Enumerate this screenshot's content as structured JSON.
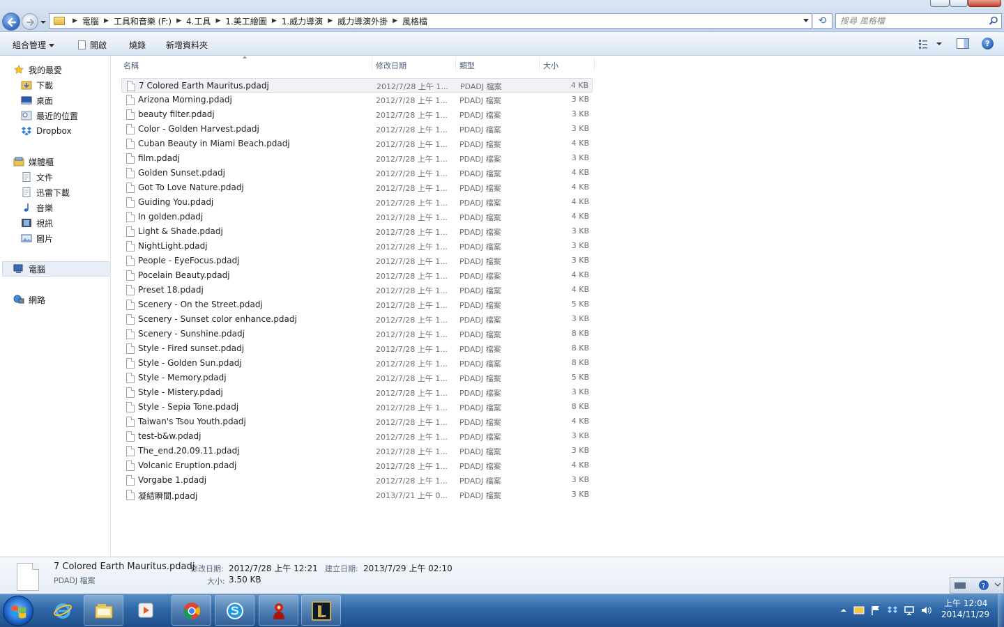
{
  "address": {
    "crumbs": [
      "電腦",
      "工具和音樂 (F:)",
      "4.工具",
      "1.美工繪圖",
      "1.威力導演",
      "威力導演外掛",
      "風格檔"
    ]
  },
  "search": {
    "placeholder": "搜尋 風格檔"
  },
  "commands": {
    "organize": "組合管理",
    "open": "開啟",
    "burn": "燒錄",
    "new_folder": "新增資料夾"
  },
  "nav": {
    "favorites": "我的最愛",
    "downloads": "下載",
    "desktop": "桌面",
    "recent": "最近的位置",
    "dropbox": "Dropbox",
    "libraries": "媒體櫃",
    "documents": "文件",
    "xunlei": "迅雷下載",
    "music": "音樂",
    "videos": "視訊",
    "pictures": "圖片",
    "computer": "電腦",
    "network": "網路"
  },
  "columns": {
    "name": "名稱",
    "modified": "修改日期",
    "type": "類型",
    "size": "大小"
  },
  "files": [
    {
      "name": "7 Colored Earth Mauritus.pdadj",
      "date": "2012/7/28 上午 1...",
      "type": "PDADJ 檔案",
      "size": "4 KB"
    },
    {
      "name": "Arizona Morning.pdadj",
      "date": "2012/7/28 上午 1...",
      "type": "PDADJ 檔案",
      "size": "3 KB"
    },
    {
      "name": "beauty filter.pdadj",
      "date": "2012/7/28 上午 1...",
      "type": "PDADJ 檔案",
      "size": "3 KB"
    },
    {
      "name": "Color - Golden Harvest.pdadj",
      "date": "2012/7/28 上午 1...",
      "type": "PDADJ 檔案",
      "size": "3 KB"
    },
    {
      "name": "Cuban Beauty in Miami Beach.pdadj",
      "date": "2012/7/28 上午 1...",
      "type": "PDADJ 檔案",
      "size": "4 KB"
    },
    {
      "name": "film.pdadj",
      "date": "2012/7/28 上午 1...",
      "type": "PDADJ 檔案",
      "size": "3 KB"
    },
    {
      "name": "Golden Sunset.pdadj",
      "date": "2012/7/28 上午 1...",
      "type": "PDADJ 檔案",
      "size": "4 KB"
    },
    {
      "name": "Got To Love Nature.pdadj",
      "date": "2012/7/28 上午 1...",
      "type": "PDADJ 檔案",
      "size": "4 KB"
    },
    {
      "name": "Guiding You.pdadj",
      "date": "2012/7/28 上午 1...",
      "type": "PDADJ 檔案",
      "size": "4 KB"
    },
    {
      "name": "In golden.pdadj",
      "date": "2012/7/28 上午 1...",
      "type": "PDADJ 檔案",
      "size": "4 KB"
    },
    {
      "name": "Light & Shade.pdadj",
      "date": "2012/7/28 上午 1...",
      "type": "PDADJ 檔案",
      "size": "3 KB"
    },
    {
      "name": "NightLight.pdadj",
      "date": "2012/7/28 上午 1...",
      "type": "PDADJ 檔案",
      "size": "3 KB"
    },
    {
      "name": "People - EyeFocus.pdadj",
      "date": "2012/7/28 上午 1...",
      "type": "PDADJ 檔案",
      "size": "3 KB"
    },
    {
      "name": "Pocelain Beauty.pdadj",
      "date": "2012/7/28 上午 1...",
      "type": "PDADJ 檔案",
      "size": "4 KB"
    },
    {
      "name": "Preset 18.pdadj",
      "date": "2012/7/28 上午 1...",
      "type": "PDADJ 檔案",
      "size": "4 KB"
    },
    {
      "name": "Scenery - On the Street.pdadj",
      "date": "2012/7/28 上午 1...",
      "type": "PDADJ 檔案",
      "size": "5 KB"
    },
    {
      "name": "Scenery - Sunset color enhance.pdadj",
      "date": "2012/7/28 上午 1...",
      "type": "PDADJ 檔案",
      "size": "3 KB"
    },
    {
      "name": "Scenery - Sunshine.pdadj",
      "date": "2012/7/28 上午 1...",
      "type": "PDADJ 檔案",
      "size": "8 KB"
    },
    {
      "name": "Style - Fired sunset.pdadj",
      "date": "2012/7/28 上午 1...",
      "type": "PDADJ 檔案",
      "size": "8 KB"
    },
    {
      "name": "Style - Golden Sun.pdadj",
      "date": "2012/7/28 上午 1...",
      "type": "PDADJ 檔案",
      "size": "8 KB"
    },
    {
      "name": "Style - Memory.pdadj",
      "date": "2012/7/28 上午 1...",
      "type": "PDADJ 檔案",
      "size": "5 KB"
    },
    {
      "name": "Style - Mistery.pdadj",
      "date": "2012/7/28 上午 1...",
      "type": "PDADJ 檔案",
      "size": "3 KB"
    },
    {
      "name": "Style - Sepia Tone.pdadj",
      "date": "2012/7/28 上午 1...",
      "type": "PDADJ 檔案",
      "size": "8 KB"
    },
    {
      "name": "Taiwan's Tsou Youth.pdadj",
      "date": "2012/7/28 上午 1...",
      "type": "PDADJ 檔案",
      "size": "4 KB"
    },
    {
      "name": "test-b&w.pdadj",
      "date": "2012/7/28 上午 1...",
      "type": "PDADJ 檔案",
      "size": "3 KB"
    },
    {
      "name": "The_end.20.09.11.pdadj",
      "date": "2012/7/28 上午 1...",
      "type": "PDADJ 檔案",
      "size": "3 KB"
    },
    {
      "name": "Volcanic Eruption.pdadj",
      "date": "2012/7/28 上午 1...",
      "type": "PDADJ 檔案",
      "size": "4 KB"
    },
    {
      "name": "Vorgabe 1.pdadj",
      "date": "2012/7/28 上午 1...",
      "type": "PDADJ 檔案",
      "size": "3 KB"
    },
    {
      "name": "凝結瞬間.pdadj",
      "date": "2013/7/21 上午 0...",
      "type": "PDADJ 檔案",
      "size": "3 KB"
    }
  ],
  "details": {
    "name": "7 Colored Earth Mauritus.pdadj",
    "type": "PDADJ 檔案",
    "modified_label": "修改日期:",
    "modified_value": "2012/7/28 上午 12:21",
    "created_label": "建立日期:",
    "created_value": "2013/7/29 上午 02:10",
    "size_label": "大小:",
    "size_value": "3.50 KB"
  },
  "clock": {
    "time": "上午 12:04",
    "date": "2014/11/29"
  },
  "colors": {
    "accent": "#2e68a8",
    "selection": "#f0f2f5"
  },
  "icons": [
    "back-arrow-icon",
    "forward-arrow-icon",
    "folder-icon",
    "refresh-icon",
    "search-icon",
    "file-icon",
    "star-icon",
    "computer-icon",
    "network-icon",
    "windows-logo-icon",
    "help-icon"
  ]
}
